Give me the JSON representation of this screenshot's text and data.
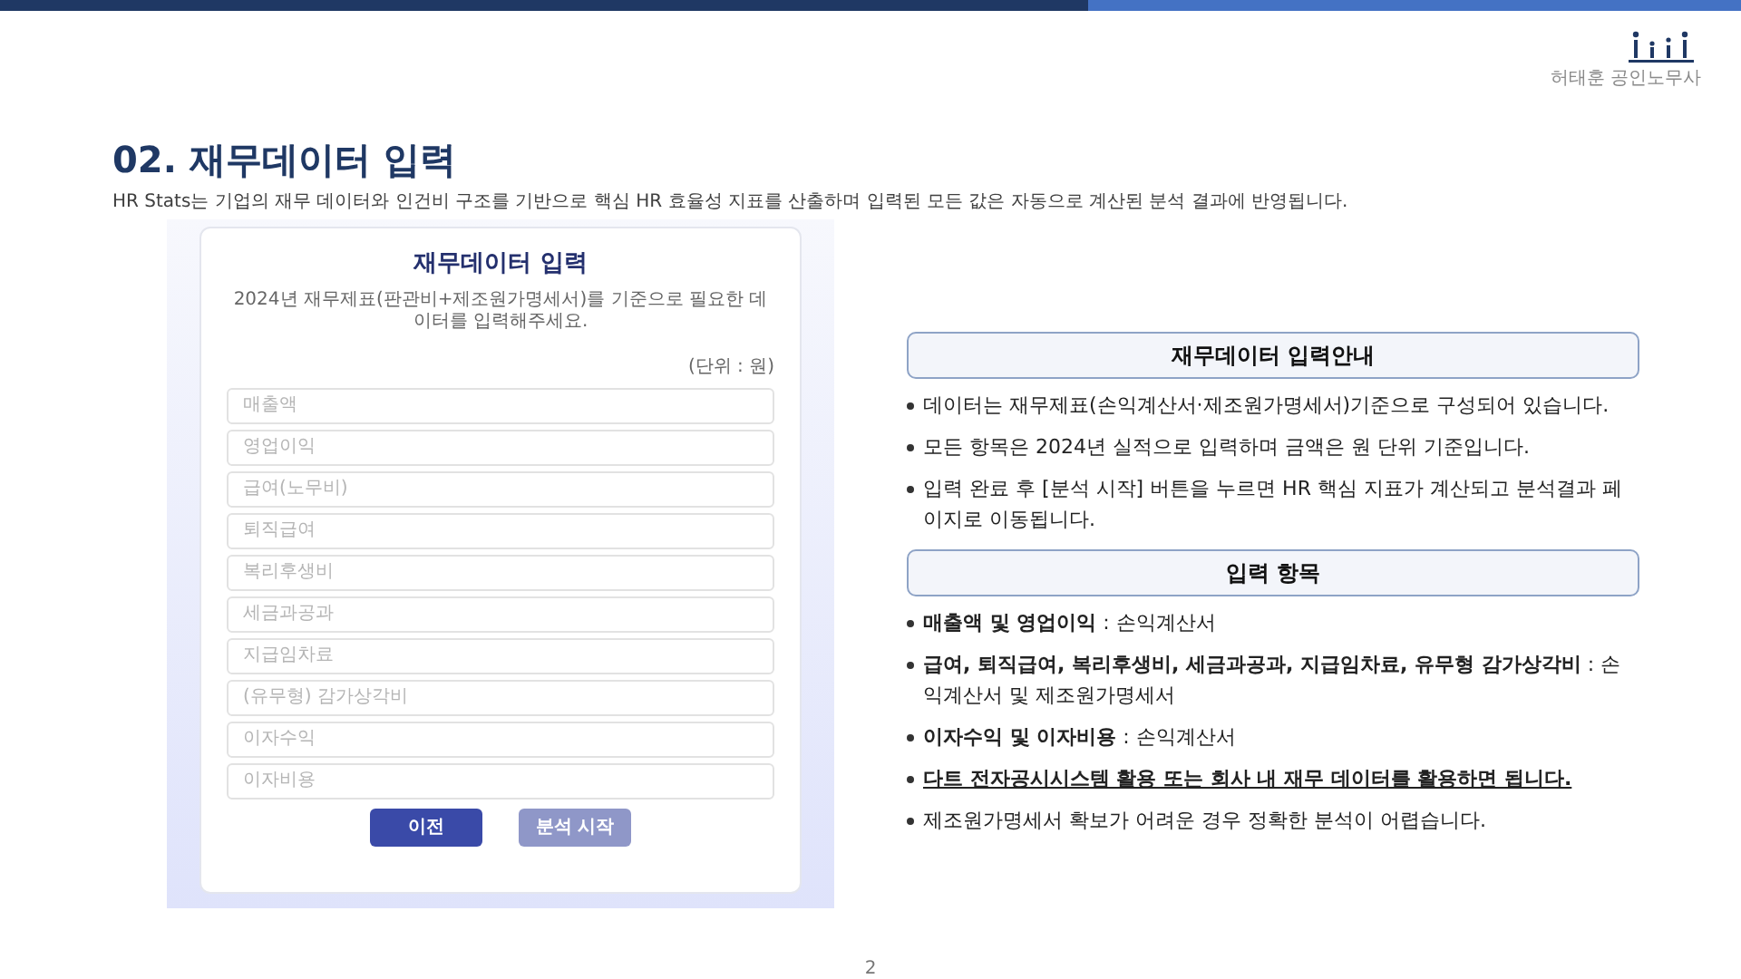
{
  "brand": {
    "name": "허태훈 공인노무사"
  },
  "title": "02. 재무데이터 입력",
  "description": "HR Stats는 기업의 재무 데이터와 인건비 구조를 기반으로 핵심 HR 효율성 지표를 산출하며 입력된 모든 값은 자동으로 계산된 분석 결과에 반영됩니다.",
  "form": {
    "title": "재무데이터 입력",
    "subtitle": "2024년 재무제표(판관비+제조원가명세서)를 기준으로 필요한 데이터를 입력해주세요.",
    "unit": "(단위 : 원)",
    "fields": [
      {
        "placeholder": "매출액"
      },
      {
        "placeholder": "영업이익"
      },
      {
        "placeholder": "급여(노무비)"
      },
      {
        "placeholder": "퇴직급여"
      },
      {
        "placeholder": "복리후생비"
      },
      {
        "placeholder": "세금과공과"
      },
      {
        "placeholder": "지급임차료"
      },
      {
        "placeholder": "(유무형) 감가상각비"
      },
      {
        "placeholder": "이자수익"
      },
      {
        "placeholder": "이자비용"
      }
    ],
    "buttons": [
      {
        "label": "이전",
        "disabled": false
      },
      {
        "label": "분석 시작",
        "disabled": true
      }
    ]
  },
  "guide": [
    {
      "heading": "재무데이터 입력안내",
      "items": [
        {
          "text": "데이터는 재무제표(손익계산서·제조원가명세서)기준으로 구성되어 있습니다.",
          "emphasis": false
        },
        {
          "text": "모든 항목은 2024년 실적으로 입력하며 금액은 원 단위 기준입니다.",
          "emphasis": false
        },
        {
          "text": "입력 완료 후 [분석 시작] 버튼을 누르면 HR 핵심 지표가 계산되고 분석결과 페이지로 이동됩니다.",
          "emphasis": false
        }
      ]
    },
    {
      "heading": "입력 항목",
      "items": [
        {
          "text": "**매출액 및 영업이익** : 손익계산서",
          "emphasis": false
        },
        {
          "text": "**급여, 퇴직급여, 복리후생비, 세금과공과, 지급임차료, 유무형 감가상각비** : 손익계산서 및 제조원가명세서",
          "emphasis": false
        },
        {
          "text": "**이자수익 및 이자비용** : 손익계산서",
          "emphasis": false
        },
        {
          "text": "**다트 전자공시시스템 활용 또는 회사 내 재무 데이터를 활용하면 됩니다.**",
          "emphasis": true
        },
        {
          "text": "제조원가명세서 확보가 어려운 경우 정확한 분석이 어렵습니다.",
          "emphasis": false
        }
      ]
    }
  ],
  "page_number": "2"
}
